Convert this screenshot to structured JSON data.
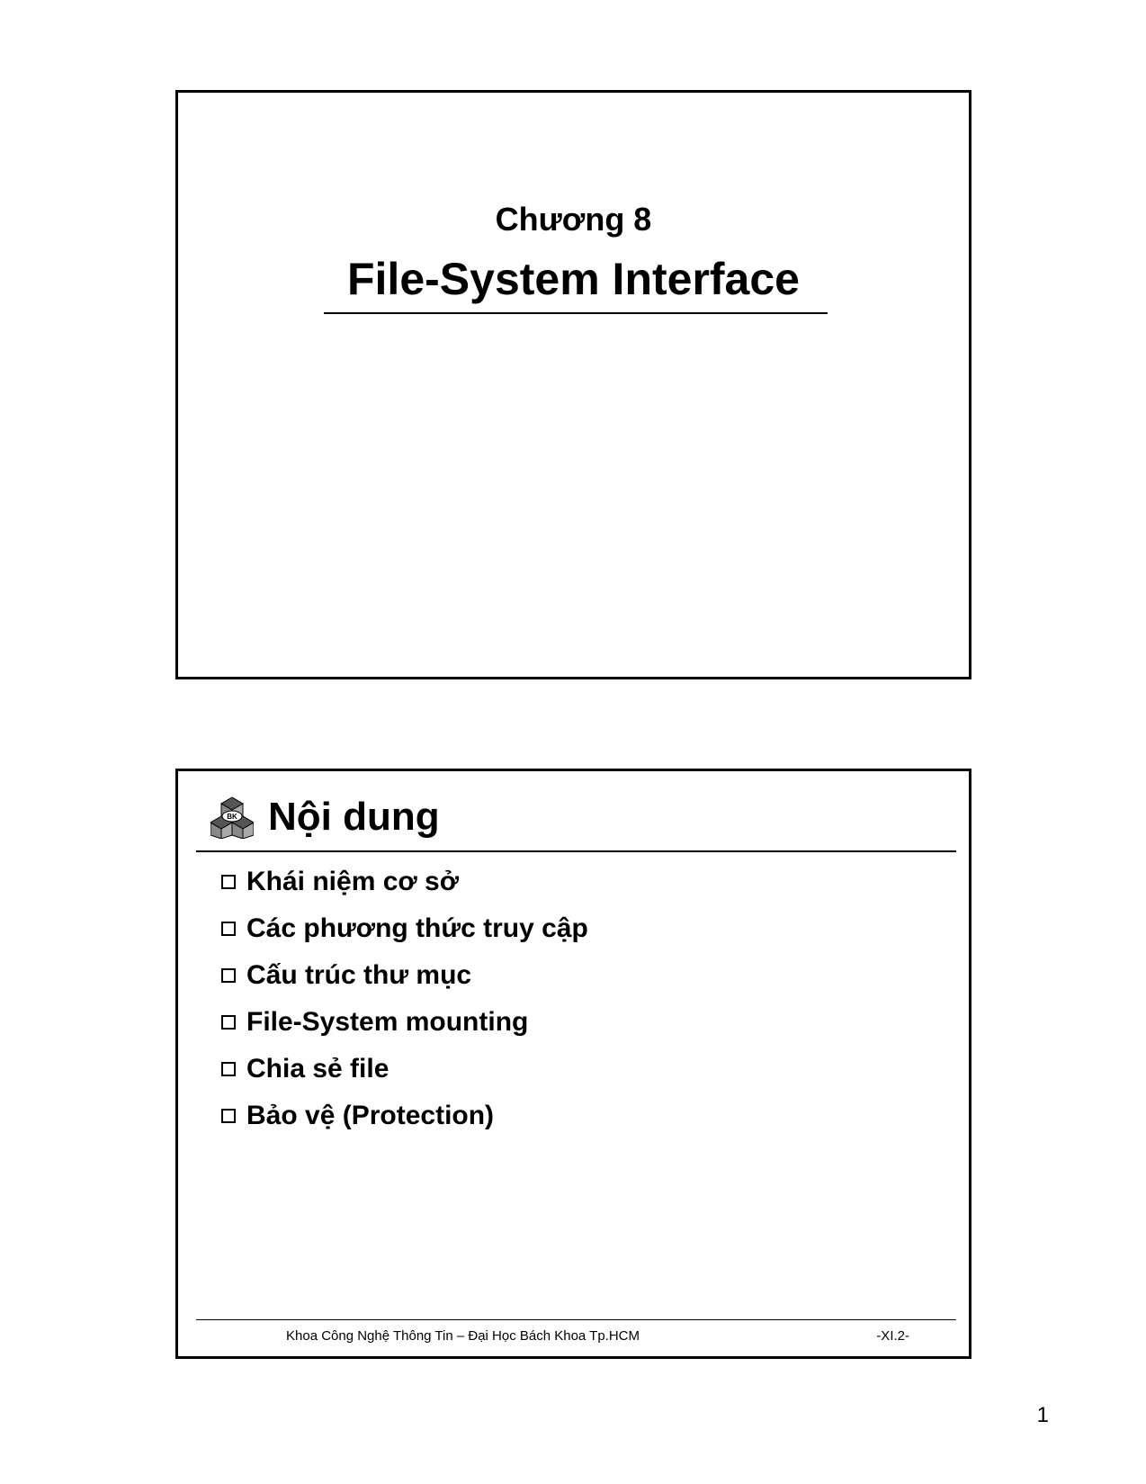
{
  "slide1": {
    "chapter": "Chương 8",
    "title": "File-System Interface"
  },
  "slide2": {
    "icon_label": "BK",
    "title": "Nội dung",
    "items": [
      "Khái niệm cơ sở",
      "Các phương thức truy cập",
      "Cấu trúc thư mục",
      "File-System mounting",
      "Chia sẻ file",
      "Bảo vệ (Protection)"
    ],
    "footer": "Khoa Công Nghệ Thông Tin – Đại Học Bách Khoa Tp.HCM",
    "footer_page": "-XI.2-"
  },
  "page_number": "1"
}
